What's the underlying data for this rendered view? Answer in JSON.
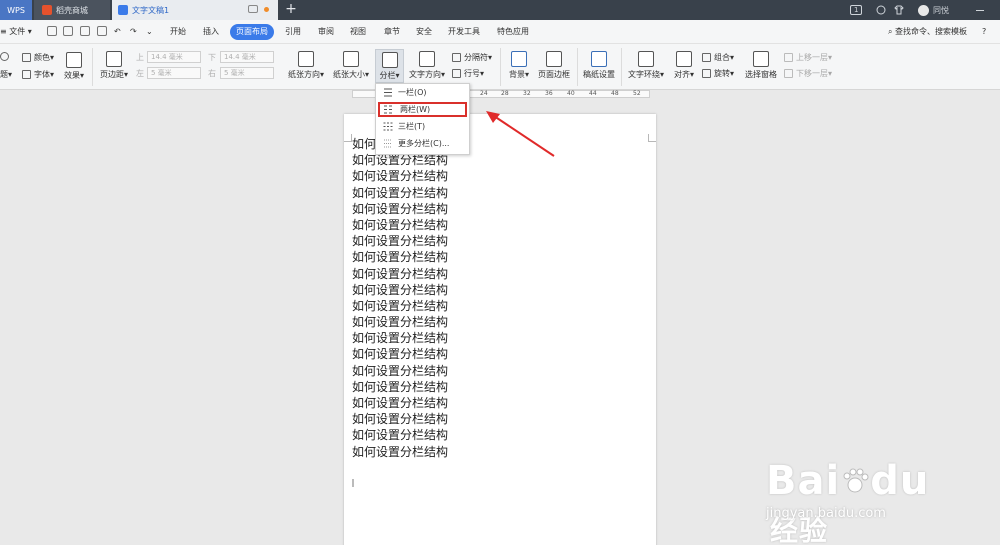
{
  "titlebar": {
    "tabs": [
      "WPS",
      "稻壳商城",
      "文字文稿1"
    ],
    "new_tab": "+",
    "badge": "1",
    "user": "同悦"
  },
  "menu": {
    "file": "文件",
    "items": [
      "开始",
      "插入",
      "页面布局",
      "引用",
      "审阅",
      "视图",
      "章节",
      "安全",
      "开发工具",
      "特色应用"
    ],
    "active_index": 2,
    "search": "查找命令、搜索模板",
    "help": "?"
  },
  "ribbon": {
    "theme_top": "颜色",
    "theme_fonts": "字体",
    "theme_effects": "效果",
    "theme_left": "题",
    "margins": "页边距",
    "top_label": "上",
    "top_value": "14.4 毫米",
    "bottom_label": "下",
    "bottom_value": "14.4 毫米",
    "left_label": "左",
    "left_value": "5 毫米",
    "right_label": "右",
    "right_value": "5 毫米",
    "orientation": "纸张方向",
    "size": "纸张大小",
    "columns": "分栏",
    "text_direction": "文字方向",
    "breaks": "分隔符",
    "line_numbers": "行号",
    "background": "背景",
    "page_border": "页面边框",
    "paper_setup": "稿纸设置",
    "text_wrap": "文字环绕",
    "align": "对齐",
    "group": "组合",
    "rotate": "旋转",
    "selection_pane": "选择窗格",
    "bring_forward": "上移一层",
    "send_backward": "下移一层"
  },
  "ruler_ticks": [
    "24",
    "28",
    "32",
    "36",
    "40",
    "44",
    "48",
    "52"
  ],
  "dropdown": {
    "items": [
      "一栏(O)",
      "两栏(W)",
      "三栏(T)",
      "更多分栏(C)..."
    ],
    "highlighted_index": 1
  },
  "document": {
    "first_line": "如何",
    "line_text": "如何设置分栏结构",
    "line_count": 20
  },
  "watermark": {
    "brand": "Bai",
    "brand_end": "du",
    "cn": "经验",
    "url": "jingyan.baidu.com"
  },
  "colors": {
    "accent": "#3b7be9",
    "highlight_border": "#d9302b",
    "arrow": "#e02a2a",
    "titlebar": "#39414b"
  }
}
